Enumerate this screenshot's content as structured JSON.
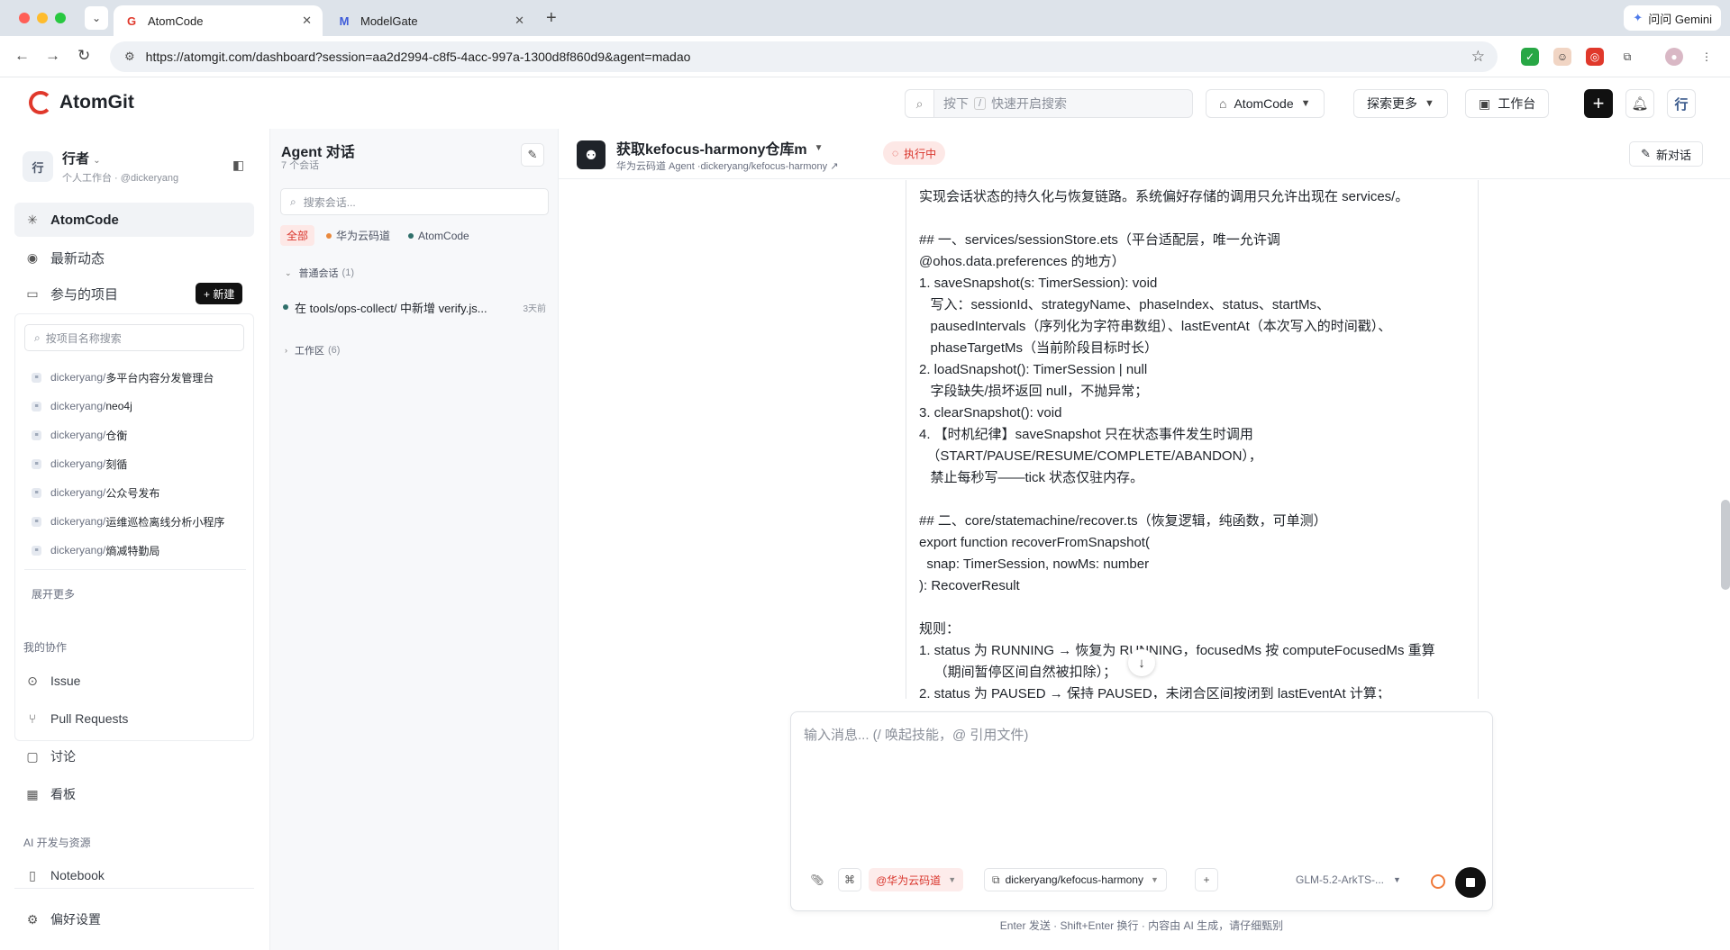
{
  "browser": {
    "tabs": [
      {
        "title": "AtomCode",
        "active": true
      },
      {
        "title": "ModelGate",
        "active": false
      }
    ],
    "url": "https://atomgit.com/dashboard?session=aa2d2994-c8f5-4acc-997a-1300d8f860d9&agent=madao",
    "gemini_label": "问问 Gemini"
  },
  "header": {
    "logo_text": "AtomGit",
    "search_prefix": "按下",
    "search_key": "/",
    "search_placeholder": "快速开启搜索",
    "atomcode_label": "AtomCode",
    "explore_label": "探索更多",
    "workbench_label": "工作台",
    "avatar_text": "行"
  },
  "sidebar": {
    "workspace_avatar": "行",
    "workspace_name": "行者",
    "workspace_sub": "个人工作台 · @dickeryang",
    "nav": [
      {
        "label": "AtomCode",
        "active": true
      },
      {
        "label": "最新动态"
      },
      {
        "label": "参与的项目"
      }
    ],
    "new_label": "+ 新建",
    "project_search_placeholder": "按项目名称搜索",
    "projects": [
      {
        "owner": "dickeryang/",
        "name": "多平台内容分发管理台"
      },
      {
        "owner": "dickeryang/",
        "name": "neo4j"
      },
      {
        "owner": "dickeryang/",
        "name": "仓衡"
      },
      {
        "owner": "dickeryang/",
        "name": "刻循"
      },
      {
        "owner": "dickeryang/",
        "name": "公众号发布"
      },
      {
        "owner": "dickeryang/",
        "name": "运维巡检离线分析小程序"
      },
      {
        "owner": "dickeryang/",
        "name": "熵减特勤局"
      }
    ],
    "expand_more": "展开更多",
    "section_collab": "我的协作",
    "collab": [
      {
        "label": "Issue"
      },
      {
        "label": "Pull Requests"
      },
      {
        "label": "讨论"
      },
      {
        "label": "看板"
      }
    ],
    "section_ai": "AI 开发与资源",
    "ai": [
      {
        "label": "Notebook"
      }
    ],
    "settings_label": "偏好设置"
  },
  "conversations": {
    "title": "Agent 对话",
    "count": "7 个会话",
    "search_placeholder": "搜索会话...",
    "filters": [
      {
        "label": "全部",
        "active": true
      },
      {
        "label": "华为云码道",
        "dot": "#e9893d"
      },
      {
        "label": "AtomCode",
        "dot": "#2f6f6a"
      }
    ],
    "group_normal": {
      "label": "普通会话",
      "count": "(1)"
    },
    "item": {
      "text": "在 tools/ops-collect/ 中新增 verify.js...",
      "time": "3天前"
    },
    "group_workspace": {
      "label": "工作区",
      "count": "(6)"
    }
  },
  "chat": {
    "title": "获取kefocus-harmony仓库m",
    "subtitle": "华为云码道 Agent ·dickeryang/kefocus-harmony ↗",
    "status": "执行中",
    "new_chat": "新对话",
    "message_lines": [
      "实现会话状态的持久化与恢复链路。系统偏好存储的调用只允许出现在 services/。",
      "",
      "## 一、services/sessionStore.ets（平台适配层，唯一允许调",
      "@ohos.data.preferences 的地方）",
      "1. saveSnapshot(s: TimerSession): void",
      "   写入：sessionId、strategyName、phaseIndex、status、startMs、",
      "   pausedIntervals（序列化为字符串数组）、lastEventAt（本次写入的时间戳）、",
      "   phaseTargetMs（当前阶段目标时长）",
      "2. loadSnapshot(): TimerSession | null",
      "   字段缺失/损坏返回 null，不抛异常；",
      "3. clearSnapshot(): void",
      "4. 【时机纪律】saveSnapshot 只在状态事件发生时调用",
      "  （START/PAUSE/RESUME/COMPLETE/ABANDON），",
      "   禁止每秒写——tick 状态仅驻内存。",
      "",
      "## 二、core/statemachine/recover.ts（恢复逻辑，纯函数，可单测）",
      "export function recoverFromSnapshot(",
      "  snap: TimerSession, nowMs: number",
      "): RecoverResult",
      "",
      "规则：",
      "1. status 为 RUNNING → 恢复为 RUNNING，focusedMs 按 computeFocusedMs 重算",
      "    （期间暂停区间自然被扣除）；",
      "2. status 为 PAUSED → 保持 PAUSED，未闭合区间按闭到 lastEventAt 计算；"
    ],
    "composer_placeholder": "输入消息...  (/ 唤起技能，@ 引用文件)",
    "agent_chip": "@华为云码道",
    "repo_chip": "dickeryang/kefocus-harmony",
    "model": "GLM-5.2-ArkTS-...",
    "footnote": "Enter 发送 · Shift+Enter 换行 · 内容由 AI 生成，请仔细甄别"
  },
  "colors": {
    "brand_red": "#e0382b",
    "status_red": "#d9342b",
    "dark": "#111111"
  }
}
